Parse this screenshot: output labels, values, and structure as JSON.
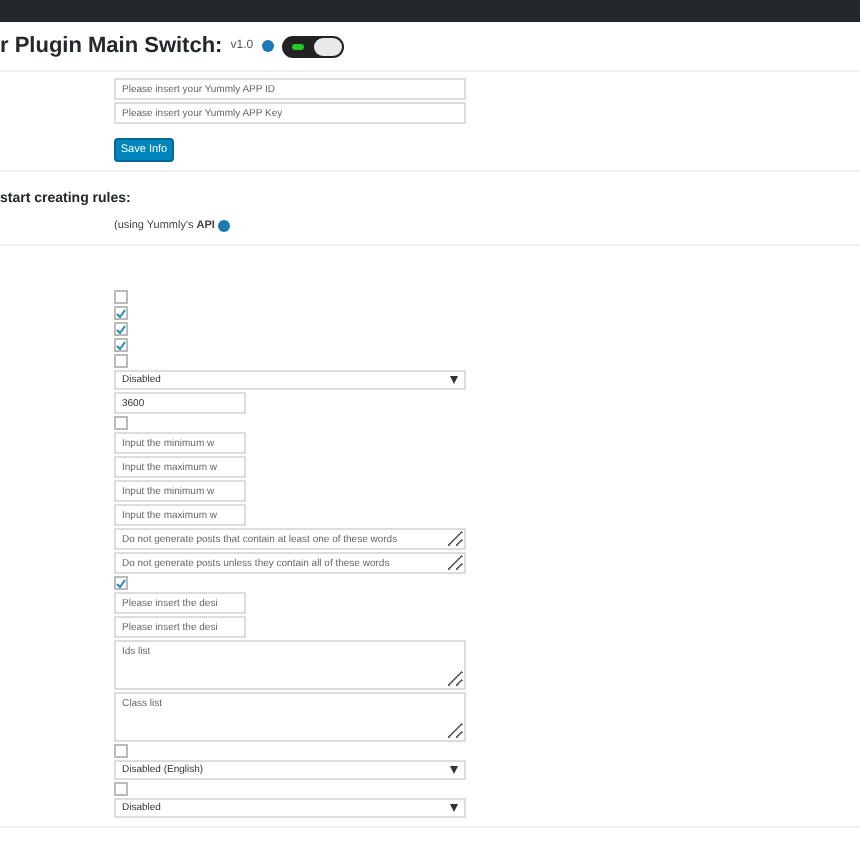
{
  "header": {
    "title": "r Plugin Main Switch:",
    "version": "v1.0",
    "switch_on": true
  },
  "credentials": [
    {
      "placeholder": "Please insert your Yummly APP ID"
    },
    {
      "placeholder": "Please insert your Yummly APP Key"
    }
  ],
  "save_button": "Save Info",
  "rules_heading": "start creating rules:",
  "api_note": "(using Yummly's **API**",
  "settings": [
    {
      "kind": "checkbox",
      "checked": false
    },
    {
      "kind": "checkbox",
      "checked": true
    },
    {
      "kind": "checkbox",
      "checked": true
    },
    {
      "kind": "checkbox",
      "checked": true
    },
    {
      "kind": "checkbox",
      "checked": false
    },
    {
      "kind": "select",
      "value": "Disabled"
    },
    {
      "kind": "short",
      "value": "3600"
    },
    {
      "kind": "checkbox",
      "checked": false
    },
    {
      "kind": "short",
      "placeholder": "Input the minimum w"
    },
    {
      "kind": "short",
      "placeholder": "Input the maximum w"
    },
    {
      "kind": "short",
      "placeholder": "Input the minimum w"
    },
    {
      "kind": "short",
      "placeholder": "Input the maximum w"
    },
    {
      "kind": "line",
      "placeholder": "Do not generate posts that contain at least one of these words"
    },
    {
      "kind": "line",
      "placeholder": "Do not generate posts unless they contain all of these words"
    },
    {
      "kind": "checkbox",
      "checked": true
    },
    {
      "kind": "short",
      "placeholder": "Please insert the desi"
    },
    {
      "kind": "short",
      "placeholder": "Please insert the desi"
    },
    {
      "kind": "area",
      "placeholder": "Ids list"
    },
    {
      "kind": "area",
      "placeholder": "Class list"
    },
    {
      "kind": "checkbox",
      "checked": false
    },
    {
      "kind": "select",
      "value": "Disabled (English)"
    },
    {
      "kind": "checkbox",
      "checked": false
    },
    {
      "kind": "select",
      "value": "Disabled"
    }
  ]
}
